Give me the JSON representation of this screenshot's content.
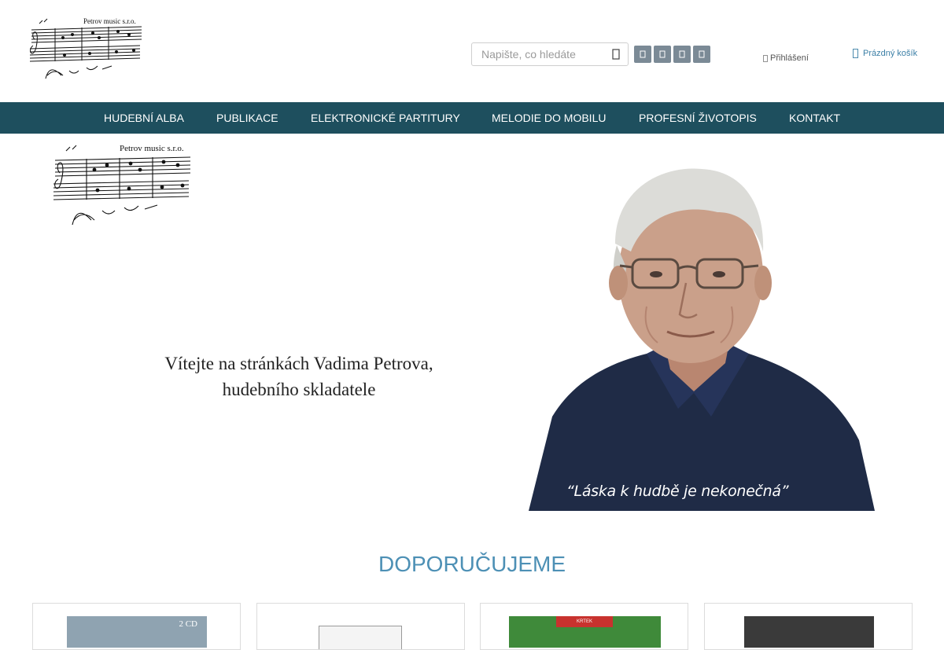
{
  "header": {
    "logo_text": "Petrov music s.r.o.",
    "search_placeholder": "Napište, co hledáte",
    "login_label": "Přihlášení",
    "cart_label": "Prázdný košík",
    "social_icons": [
      "facebook-icon",
      "youtube-icon",
      "instagram-icon",
      "twitter-icon"
    ]
  },
  "nav": {
    "items": [
      {
        "label": "HUDEBNÍ ALBA"
      },
      {
        "label": "PUBLIKACE"
      },
      {
        "label": "ELEKTRONICKÉ PARTITURY"
      },
      {
        "label": "MELODIE DO MOBILU"
      },
      {
        "label": "PROFESNÍ ŽIVOTOPIS"
      },
      {
        "label": "KONTAKT"
      }
    ]
  },
  "hero": {
    "logo_text": "Petrov music s.r.o.",
    "welcome_line1": "Vítejte na stránkách Vadima Petrova,",
    "welcome_line2": "hudebního skladatele",
    "quote": "“Láska k hudbě je nekonečná”"
  },
  "recommend": {
    "title": "DOPORUČUJEME",
    "cards": [
      {
        "cover_text": "2 CD"
      },
      {
        "cover_text": ""
      },
      {
        "cover_text": "KRTEK"
      },
      {
        "cover_text": ""
      }
    ]
  },
  "colors": {
    "nav_bg": "#1e4f5e",
    "accent": "#4d90b5",
    "social_bg": "#7b8a96"
  }
}
